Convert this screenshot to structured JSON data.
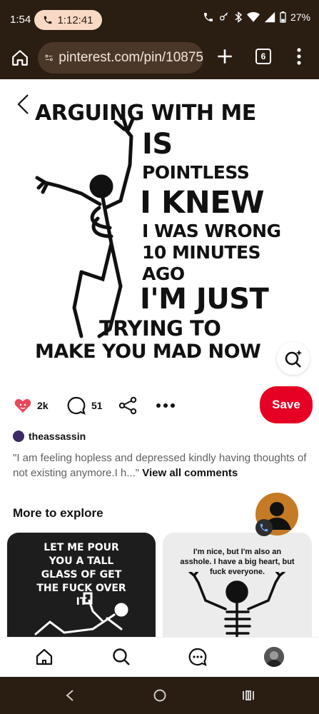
{
  "status_bar": {
    "time": "1:54",
    "call_timer": "1:12:41",
    "battery": "27%"
  },
  "browser": {
    "url": "pinterest.com/pin/10875",
    "tab_count": "6"
  },
  "pin": {
    "image_lines": [
      "ARGUING WITH ME",
      "IS",
      "POINTLESS",
      "I KNEW",
      "I WAS WRONG",
      "10 MINUTES",
      "AGO",
      "I'M JUST",
      "TRYING TO",
      "MAKE YOU MAD NOW"
    ]
  },
  "actions": {
    "likes": "2k",
    "comments": "51",
    "save_label": "Save"
  },
  "creator": {
    "name": "theassassin"
  },
  "comment": {
    "text": "\"I am feeling hopless and depressed kindly having thoughts of not existing anymore.I h...\"",
    "view_all": "View all comments"
  },
  "explore": {
    "title": "More to explore",
    "cards": [
      {
        "text": "LET ME POUR YOU A TALL GLASS OF GET THE FUCK OVER IT"
      },
      {
        "text": "I'm nice, but I'm also an asshole. I have a big heart, but fuck everyone."
      }
    ]
  },
  "colors": {
    "brand_red": "#e60023",
    "chrome_bg": "#2a1d12",
    "url_bg": "#4a3728"
  }
}
